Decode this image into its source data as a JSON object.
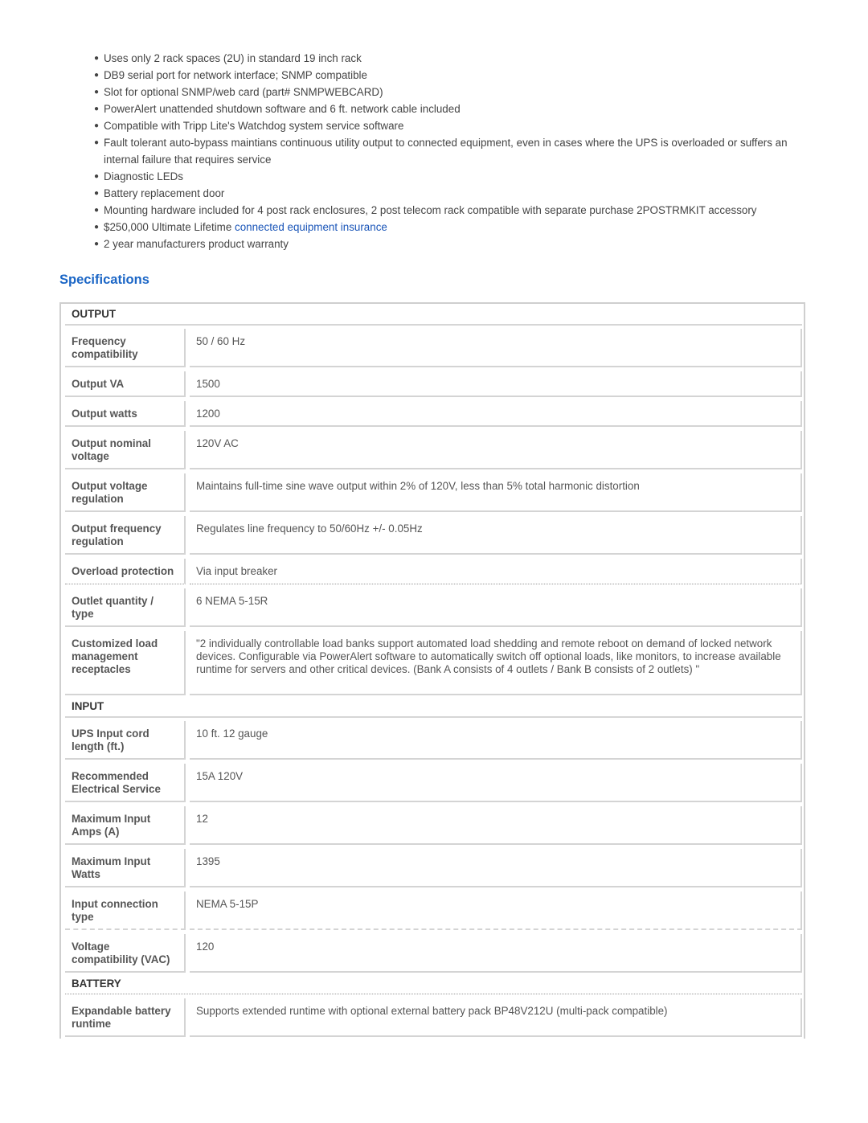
{
  "features": [
    {
      "text": "Uses only 2 rack spaces (2U) in standard 19 inch rack"
    },
    {
      "text": "DB9 serial port for network interface; SNMP compatible"
    },
    {
      "text": "Slot for optional SNMP/web card (part# SNMPWEBCARD)"
    },
    {
      "text": "PowerAlert unattended shutdown software and 6 ft. network cable included"
    },
    {
      "text": "Compatible with Tripp Lite's Watchdog system service software"
    },
    {
      "text": "Fault tolerant auto-bypass maintians continuous utility output to connected equipment, even in cases where the UPS is overloaded or suffers an internal failure that requires service"
    },
    {
      "text": "Diagnostic LEDs"
    },
    {
      "text": "Battery replacement door"
    },
    {
      "text": "Mounting hardware included for 4 post rack enclosures, 2 post telecom rack compatible with separate purchase 2POSTRMKIT accessory"
    },
    {
      "text": "$250,000 Ultimate Lifetime ",
      "link": "connected equipment insurance"
    },
    {
      "text": "2 year manufacturers product warranty"
    }
  ],
  "bullet_glyph": "●",
  "specifications": {
    "title": "Specifications",
    "sections": [
      {
        "name": "OUTPUT",
        "rows": [
          {
            "label": "Frequency compatibility",
            "value": "50 / 60 Hz"
          },
          {
            "label": "Output VA",
            "value": "1500"
          },
          {
            "label": "Output watts",
            "value": "1200"
          },
          {
            "label": "Output nominal voltage",
            "value": "120V AC"
          },
          {
            "label": "Output voltage regulation",
            "value": "Maintains full-time sine wave output within 2% of 120V, less than 5% total harmonic distortion"
          },
          {
            "label": "Output frequency regulation",
            "value": "Regulates line frequency to 50/60Hz +/- 0.05Hz"
          },
          {
            "label": "Overload protection",
            "value": "Via input breaker"
          },
          {
            "label": "Outlet quantity / type",
            "value": "6 NEMA 5-15R"
          },
          {
            "label": "Customized load management receptacles",
            "value": "\"2 individually controllable load banks support automated load shedding and remote reboot on demand of locked network devices. Configurable via PowerAlert software to automatically switch off optional loads, like monitors, to increase available runtime for servers and other critical devices. (Bank A consists of 4 outlets / Bank B consists of 2 outlets) \""
          }
        ]
      },
      {
        "name": "INPUT",
        "rows": [
          {
            "label": "UPS Input cord length (ft.)",
            "value": "10 ft. 12 gauge"
          },
          {
            "label": "Recommended Electrical Service",
            "value": "15A 120V"
          },
          {
            "label": "Maximum Input Amps (A)",
            "value": "12"
          },
          {
            "label": "Maximum Input Watts",
            "value": "1395"
          },
          {
            "label": "Input connection type",
            "value": "NEMA 5-15P"
          },
          {
            "label": "Voltage compatibility (VAC)",
            "value": "120"
          }
        ]
      },
      {
        "name": "BATTERY",
        "rows": [
          {
            "label": "Expandable battery runtime",
            "value": "Supports extended runtime with optional external battery pack BP48V212U (multi-pack compatible)"
          }
        ]
      }
    ]
  }
}
